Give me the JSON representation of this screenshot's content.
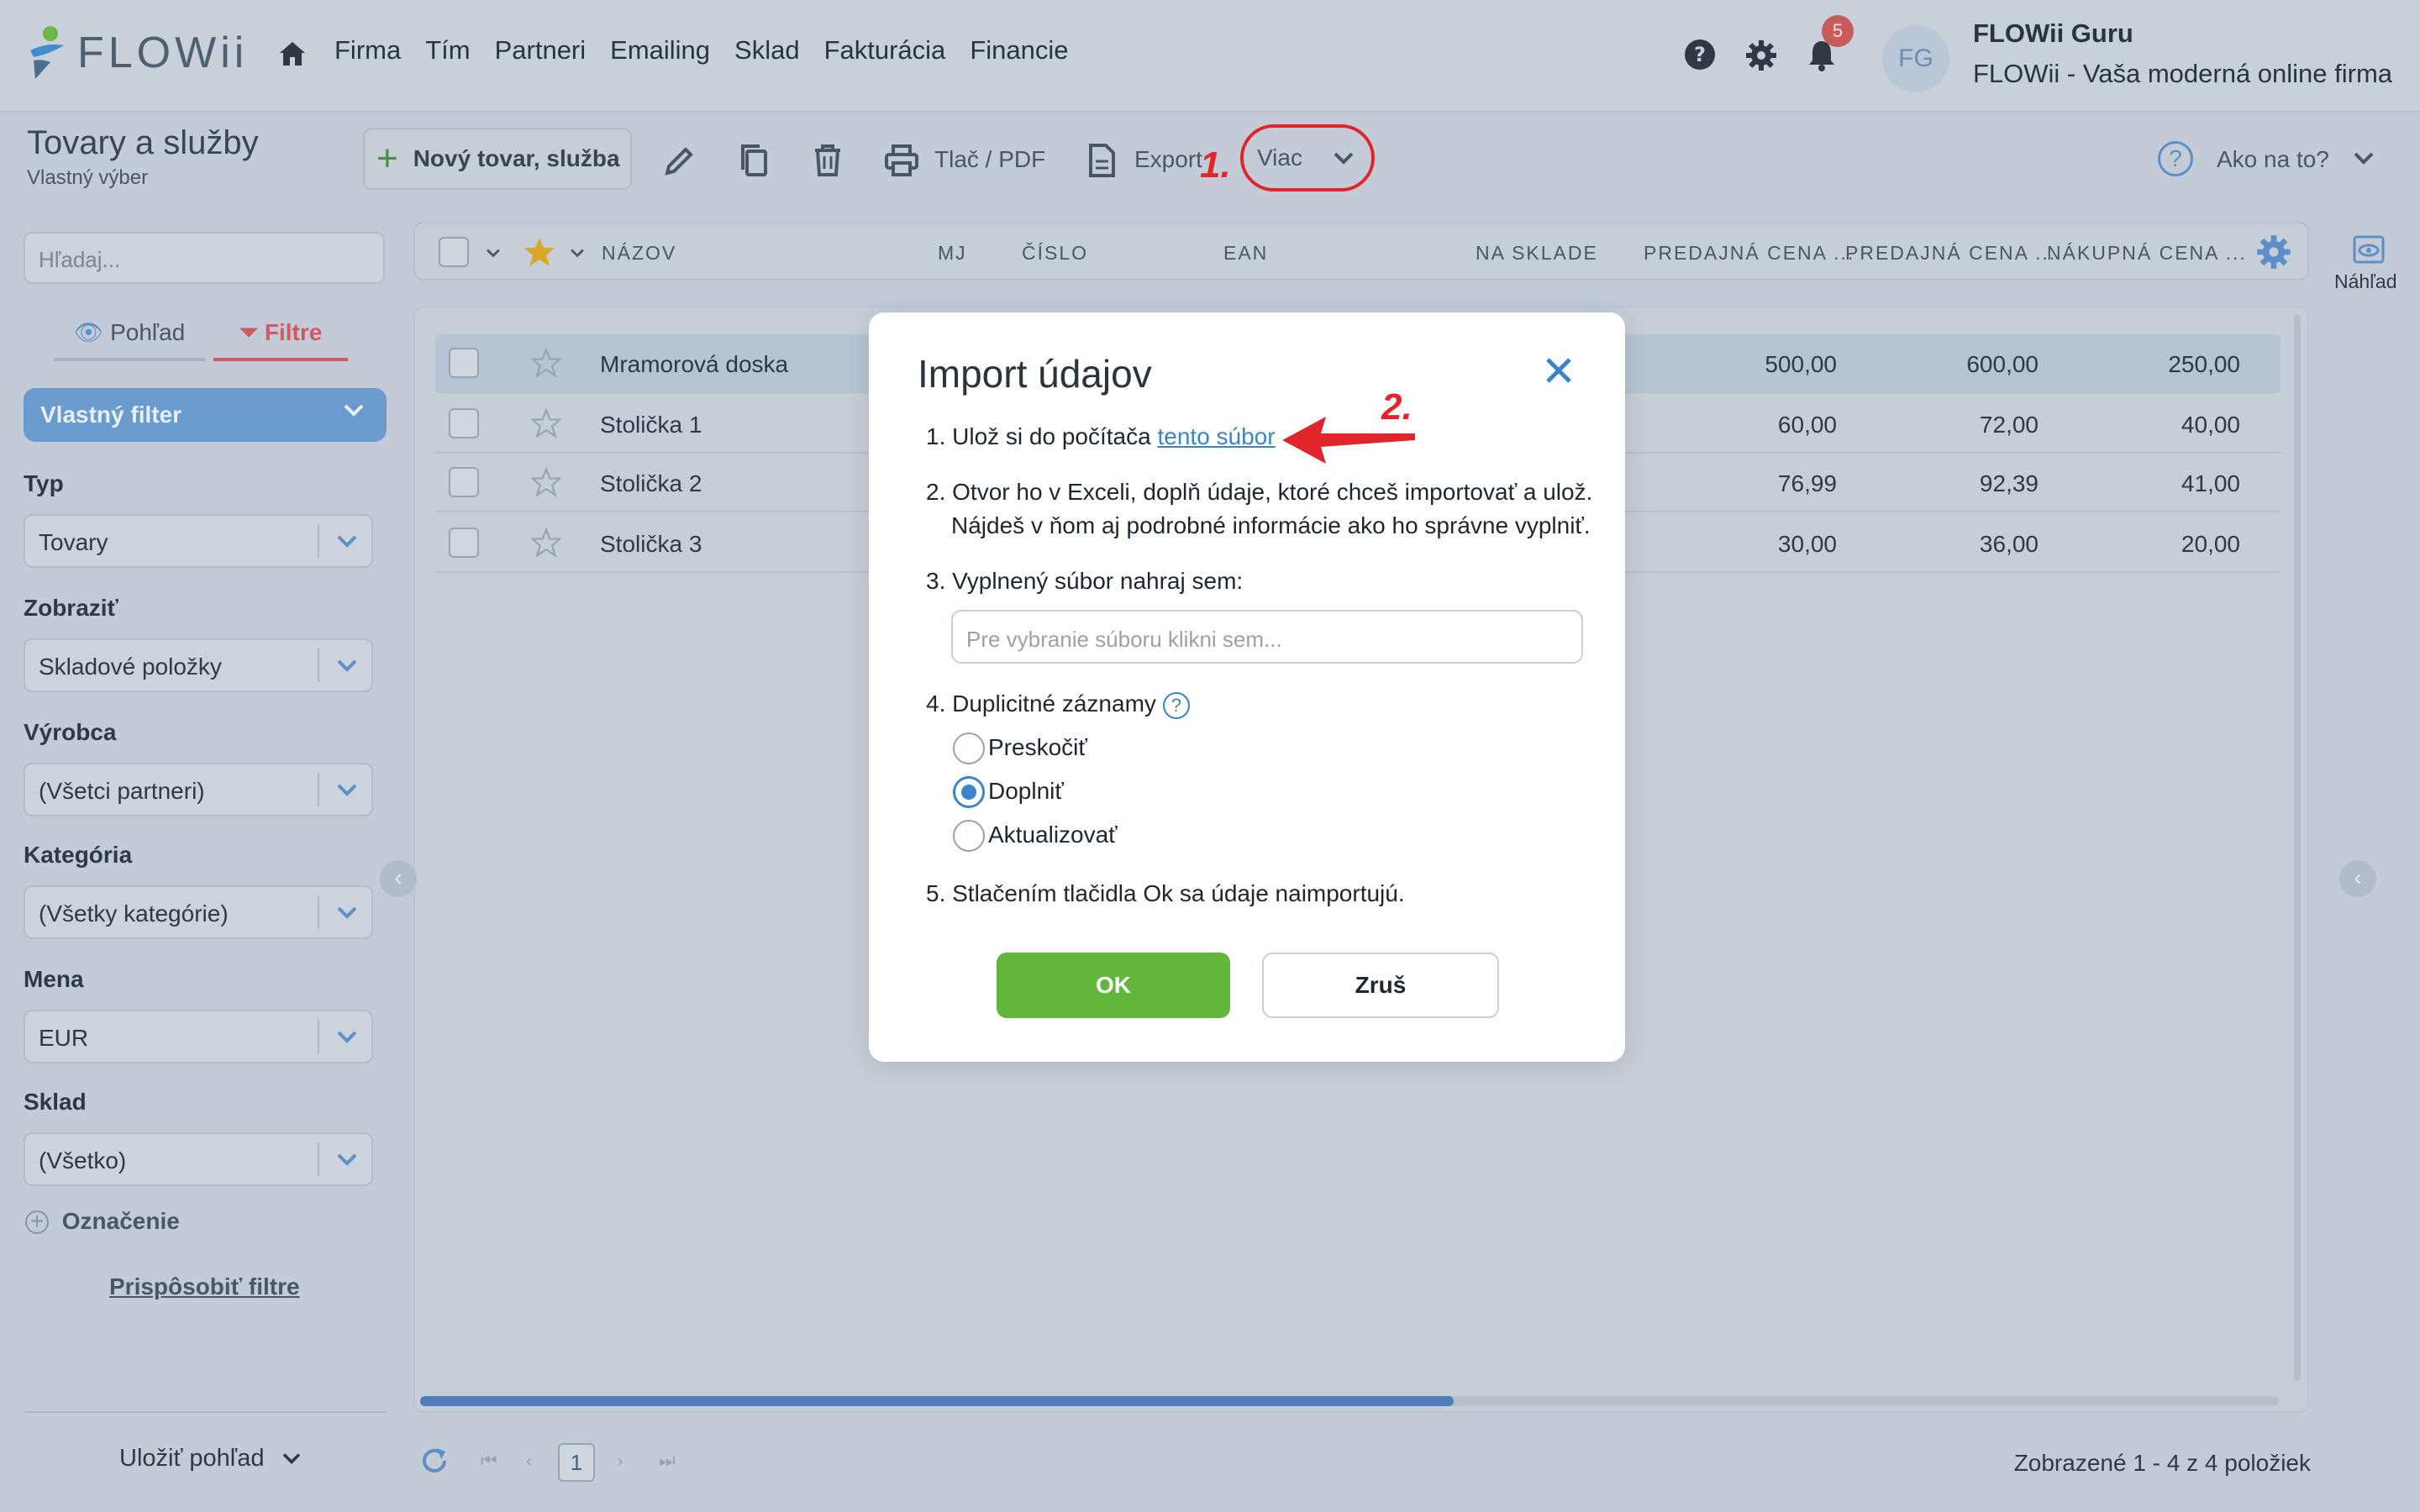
{
  "nav": {
    "logo_text": "FLOWii",
    "items": [
      "Firma",
      "Tím",
      "Partneri",
      "Emailing",
      "Sklad",
      "Fakturácia",
      "Financie"
    ],
    "notification_count": "5",
    "user_initials": "FG",
    "user_name": "FLOWii Guru",
    "user_firm": "FLOWii - Vaša moderná online firma"
  },
  "toolbar": {
    "title": "Tovary a služby",
    "subtitle": "Vlastný výber",
    "new_label": "Nový tovar, služba",
    "print_label": "Tlač / PDF",
    "export_label": "Export",
    "more_label": "Viac",
    "help_label": "Ako na to?",
    "marker1": "1.",
    "marker2": "2."
  },
  "sidebar": {
    "search_placeholder": "Hľadaj...",
    "tab_view": "Pohľad",
    "tab_filters": "Filtre",
    "custom_filter": "Vlastný filter",
    "filters": [
      {
        "label": "Typ",
        "value": "Tovary"
      },
      {
        "label": "Zobraziť",
        "value": "Skladové položky"
      },
      {
        "label": "Výrobca",
        "value": "(Všetci partneri)"
      },
      {
        "label": "Kategória",
        "value": "(Všetky kategórie)"
      },
      {
        "label": "Mena",
        "value": "EUR"
      },
      {
        "label": "Sklad",
        "value": "(Všetko)"
      }
    ],
    "oznacenie": "Označenie",
    "customize": "Prispôsobiť filtre",
    "save_view": "Uložiť pohľad"
  },
  "table": {
    "headers": [
      "NÁZOV",
      "MJ",
      "ČÍSLO",
      "EAN",
      "NA SKLADE",
      "PREDAJNÁ CENA ...",
      "PREDAJNÁ CENA ...",
      "NÁKUPNÁ CENA ..."
    ],
    "rows": [
      {
        "name": "Mramorová doska",
        "p1": "500,00",
        "p2": "600,00",
        "p3": "250,00"
      },
      {
        "name": "Stolička 1",
        "p1": "60,00",
        "p2": "72,00",
        "p3": "40,00"
      },
      {
        "name": "Stolička 2",
        "p1": "76,99",
        "p2": "92,39",
        "p3": "41,00"
      },
      {
        "name": "Stolička 3",
        "p1": "30,00",
        "p2": "36,00",
        "p3": "20,00"
      }
    ],
    "preview_label": "Náhľad",
    "page": "1",
    "summary": "Zobrazené 1 - 4 z 4 položiek"
  },
  "dialog": {
    "title": "Import údajov",
    "step1_prefix": "1. Ulož si do počítača ",
    "step1_link": "tento súbor",
    "step2_line1": "2. Otvor ho v Exceli, doplň údaje, ktoré chceš importovať a ulož.",
    "step2_line2": "Nájdeš v ňom aj podrobné informácie ako ho správne vyplniť.",
    "step3": "3. Vyplnený súbor nahraj sem:",
    "file_placeholder": "Pre vybranie súboru klikni sem...",
    "step4": "4. Duplicitné záznamy",
    "options": [
      "Preskočiť",
      "Doplniť",
      "Aktualizovať"
    ],
    "selected_option": "Doplniť",
    "step5": "5. Stlačením tlačidla Ok sa údaje naimportujú.",
    "ok": "OK",
    "cancel": "Zruš"
  },
  "colors": {
    "accent": "#3a84c8",
    "ok_green": "#62b63c",
    "annotation_red": "#e0262a"
  }
}
